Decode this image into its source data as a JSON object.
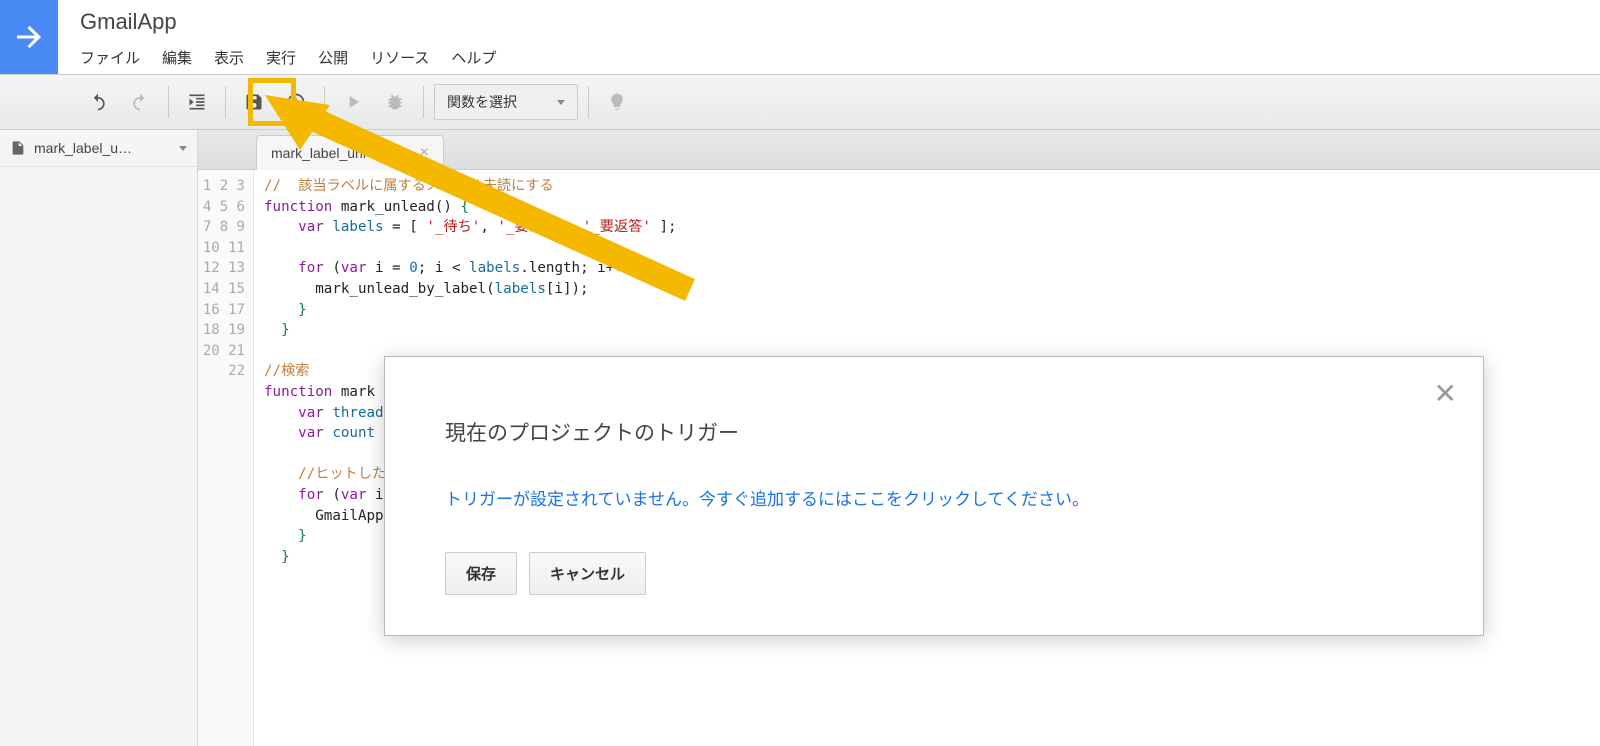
{
  "app": {
    "title": "GmailApp"
  },
  "menu": {
    "file": "ファイル",
    "edit": "編集",
    "view": "表示",
    "run": "実行",
    "publish": "公開",
    "resource": "リソース",
    "help": "ヘルプ"
  },
  "toolbar": {
    "func_select": "関数を選択"
  },
  "sidebar": {
    "file_name": "mark_label_u…"
  },
  "editor": {
    "tab_label": "mark_label_unread.gs",
    "lines": [
      {
        "n": 1,
        "type": "comment",
        "text": "//  該当ラベルに属するメールを未読にする"
      },
      {
        "n": 2,
        "type": "func_decl",
        "kw1": "function",
        "name": " mark_unlead",
        "rest": "() ",
        "brace": "{"
      },
      {
        "n": 3,
        "type": "var_decl",
        "indent": "    ",
        "kw": "var",
        "var": " labels ",
        "eq": "= [ ",
        "s1": "'_待ち'",
        "c1": ", ",
        "s2": "'_要確認'",
        "c2": ", ",
        "s3": "'_要返答'",
        "end": " ];"
      },
      {
        "n": 4,
        "type": "blank"
      },
      {
        "n": 5,
        "type": "for",
        "indent": "    ",
        "kw": "for",
        "text1": " (",
        "kw2": "var",
        "text2": " i = ",
        "num": "0",
        "text3": "; i < ",
        "var": "labels",
        "text4": ".length; i++ ){"
      },
      {
        "n": 6,
        "type": "plain",
        "indent": "      ",
        "text": "mark_unlead_by_label(",
        "var": "labels",
        "text2": "[i]);"
      },
      {
        "n": 7,
        "type": "close",
        "indent": "    ",
        "brace": "}"
      },
      {
        "n": 8,
        "type": "close",
        "indent": "  ",
        "brace": "}"
      },
      {
        "n": 9,
        "type": "blank"
      },
      {
        "n": 10,
        "type": "comment",
        "text": "//検索"
      },
      {
        "n": 11,
        "type": "func_decl",
        "kw1": "function",
        "name": " mark"
      },
      {
        "n": 12,
        "type": "var_partial",
        "indent": "    ",
        "kw": "var",
        "var": " threads"
      },
      {
        "n": 13,
        "type": "var_partial2",
        "indent": "    ",
        "kw": "var",
        "var": " count ",
        "eq": "="
      },
      {
        "n": 14,
        "type": "blank"
      },
      {
        "n": 15,
        "type": "comment",
        "indent": "    ",
        "text": "//ヒットした結"
      },
      {
        "n": 16,
        "type": "for_partial",
        "indent": "    ",
        "kw": "for",
        "text1": " (",
        "kw2": "var",
        "text2": " i"
      },
      {
        "n": 17,
        "type": "plain2",
        "indent": "      ",
        "text": "GmailApp"
      },
      {
        "n": 18,
        "type": "close",
        "indent": "    ",
        "brace": "}"
      },
      {
        "n": 19,
        "type": "close",
        "indent": "  ",
        "brace": "}"
      },
      {
        "n": 20,
        "type": "blank"
      },
      {
        "n": 21,
        "type": "blank"
      },
      {
        "n": 22,
        "type": "blank"
      }
    ]
  },
  "dialog": {
    "title": "現在のプロジェクトのトリガー",
    "message": "トリガーが設定されていません。今すぐ追加するにはここをクリックしてください。",
    "save": "保存",
    "cancel": "キャンセル"
  }
}
